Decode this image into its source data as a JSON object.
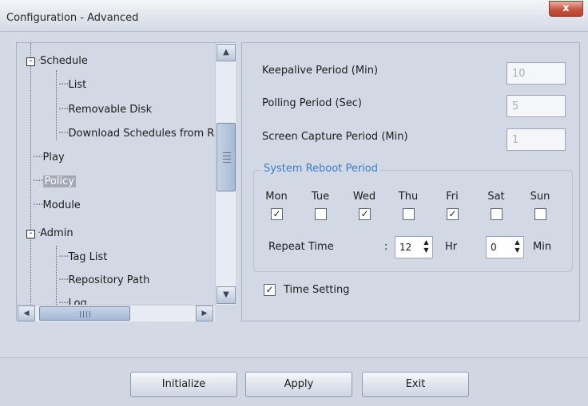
{
  "window": {
    "title": "Configuration - Advanced",
    "close_glyph": "x"
  },
  "tree": {
    "items": [
      {
        "label": "Schedule",
        "expander": "-"
      },
      {
        "label": "List"
      },
      {
        "label": "Removable Disk"
      },
      {
        "label": "Download Schedules from R"
      },
      {
        "label": "Play"
      },
      {
        "label": "Policy",
        "selected": true
      },
      {
        "label": "Module"
      },
      {
        "label": "Admin",
        "expander": "-"
      },
      {
        "label": "Tag List"
      },
      {
        "label": "Repository Path"
      },
      {
        "label": "Log"
      }
    ]
  },
  "policy": {
    "keepalive": {
      "label": "Keepalive Period (Min)",
      "value": "10"
    },
    "polling": {
      "label": "Polling Period (Sec)",
      "value": "5"
    },
    "screen_capture": {
      "label": "Screen Capture Period (Min)",
      "value": "1"
    },
    "reboot": {
      "title": "System Reboot Period",
      "days": [
        {
          "label": "Mon",
          "checked": true
        },
        {
          "label": "Tue",
          "checked": false
        },
        {
          "label": "Wed",
          "checked": true
        },
        {
          "label": "Thu",
          "checked": false
        },
        {
          "label": "Fri",
          "checked": true
        },
        {
          "label": "Sat",
          "checked": false
        },
        {
          "label": "Sun",
          "checked": false
        }
      ],
      "repeat_label": "Repeat Time",
      "colon": ":",
      "hour_value": "12",
      "hour_unit": "Hr",
      "minute_value": "0",
      "minute_unit": "Min"
    },
    "time_setting": {
      "label": "Time Setting",
      "checked": true
    }
  },
  "buttons": {
    "initialize": "Initialize",
    "apply": "Apply",
    "exit": "Exit"
  },
  "colors": {
    "group_title": "#3d7cc4",
    "selected_bg": "#a3a9b5",
    "close_button": "#c8553f"
  }
}
